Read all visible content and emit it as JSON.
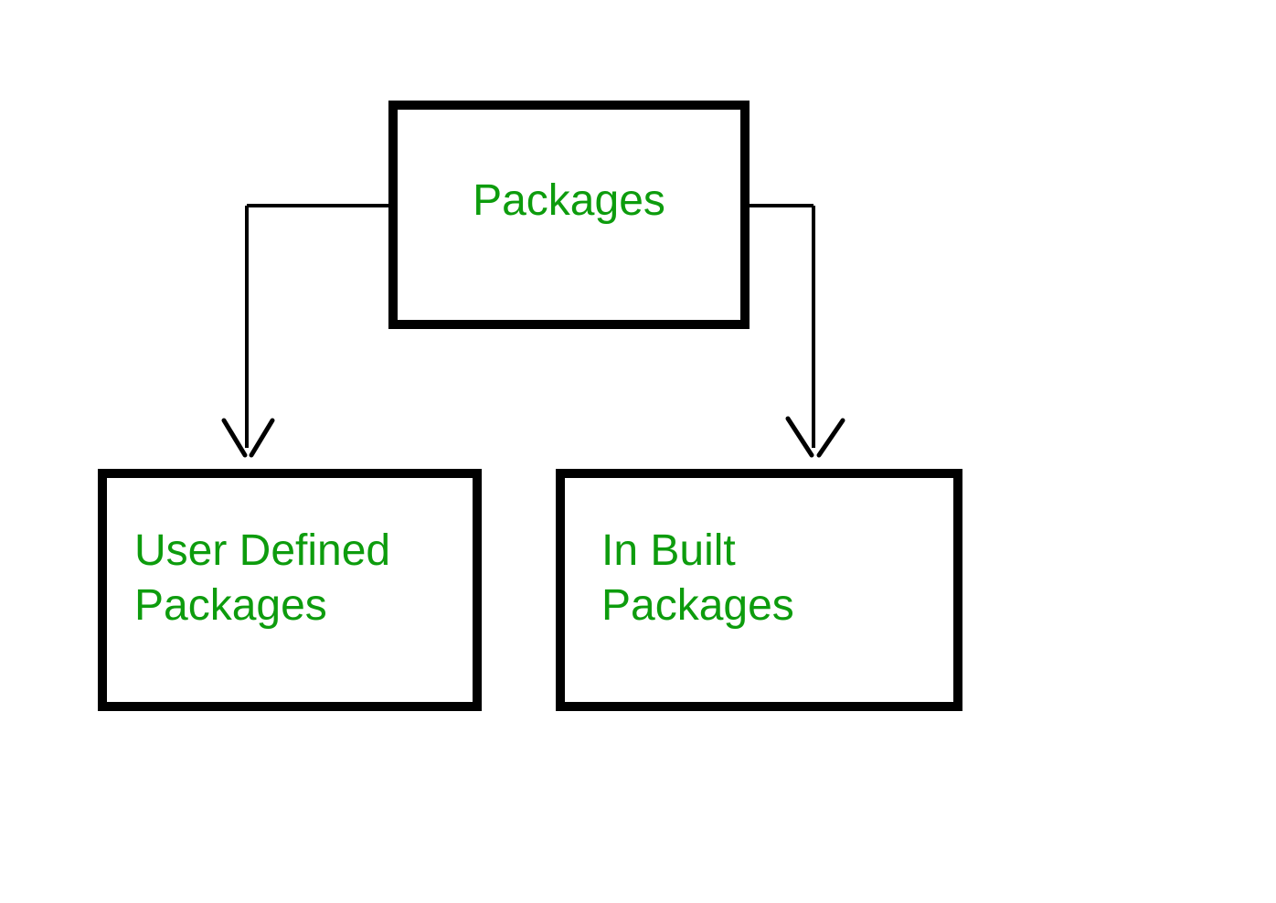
{
  "diagram": {
    "root": {
      "label": "Packages"
    },
    "children": [
      {
        "id": "user-defined",
        "label": "User Defined Packages"
      },
      {
        "id": "in-built",
        "label": "In Built Packages"
      }
    ]
  }
}
